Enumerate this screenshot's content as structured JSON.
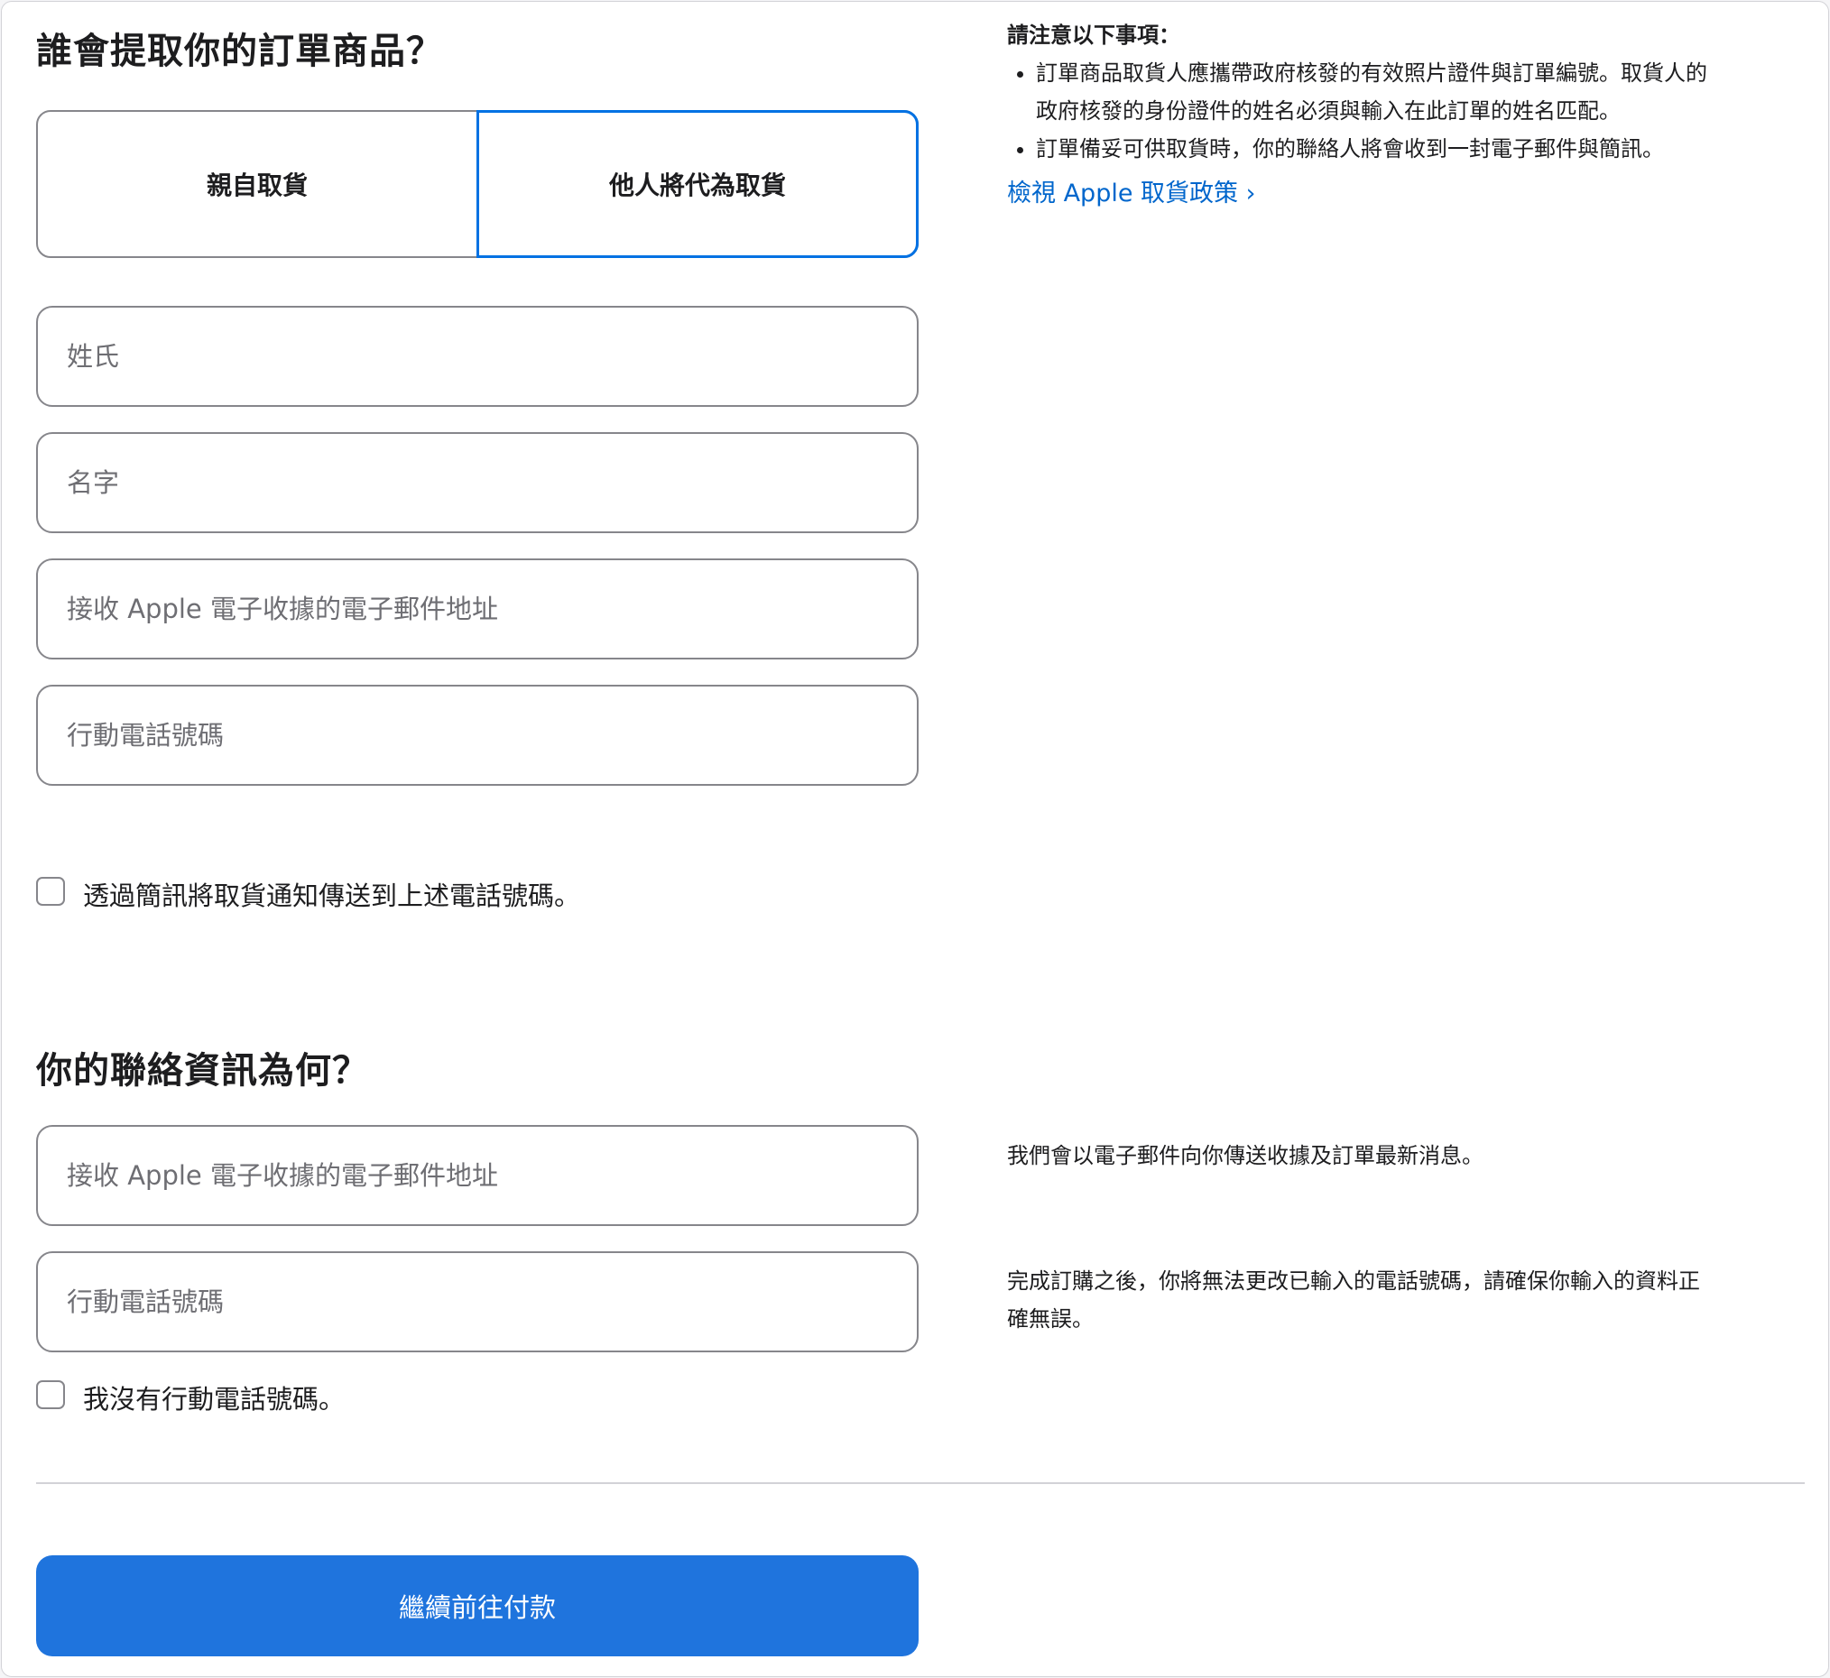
{
  "pickup": {
    "heading": "誰會提取你的訂單商品？",
    "options": [
      {
        "label": "親自取貨",
        "selected": false
      },
      {
        "label": "他人將代為取貨",
        "selected": true
      }
    ],
    "fields": {
      "last_name_placeholder": "姓氏",
      "first_name_placeholder": "名字",
      "email_placeholder": "接收 Apple 電子收據的電子郵件地址",
      "phone_placeholder": "行動電話號碼"
    },
    "sms_checkbox_label": "透過簡訊將取貨通知傳送到上述電話號碼。",
    "notes_title": "請注意以下事項：",
    "notes": [
      "訂單商品取貨人應攜帶政府核發的有效照片證件與訂單編號。取貨人的政府核發的身份證件的姓名必須與輸入在此訂單的姓名匹配。",
      "訂單備妥可供取貨時，你的聯絡人將會收到一封電子郵件與簡訊。"
    ],
    "policy_link": "檢視 Apple 取貨政策",
    "policy_link_chevron": "›"
  },
  "contact": {
    "heading": "你的聯絡資訊為何？",
    "email_placeholder": "接收 Apple 電子收據的電子郵件地址",
    "phone_placeholder": "行動電話號碼",
    "no_phone_label": "我沒有行動電話號碼。",
    "email_note": "我們會以電子郵件向你傳送收據及訂單最新消息。",
    "phone_note": "完成訂購之後，你將無法更改已輸入的電話號碼，請確保你輸入的資料正確無誤。"
  },
  "continue_button": "繼續前往付款",
  "colors": {
    "accent": "#0071e3",
    "button": "#1f74dd",
    "link": "#0066cc"
  }
}
